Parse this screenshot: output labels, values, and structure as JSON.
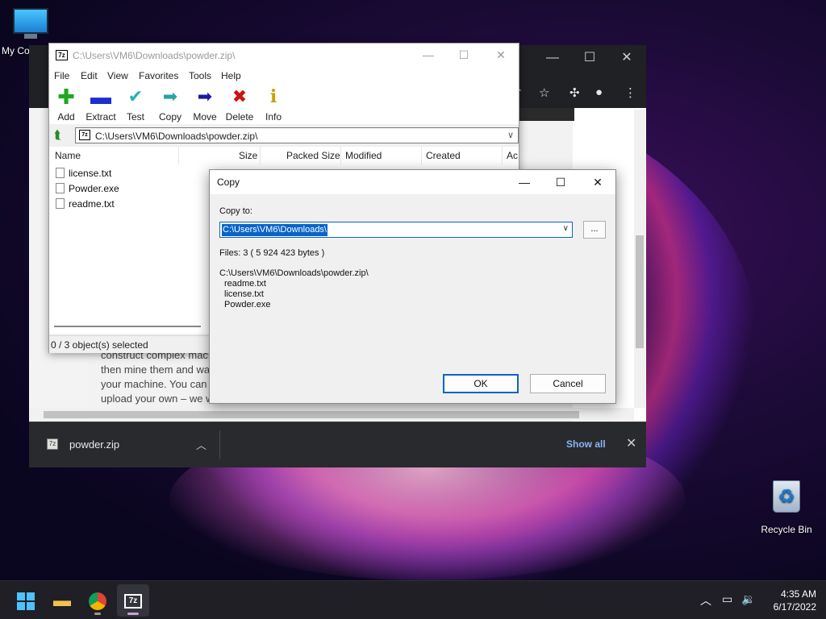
{
  "desktop": {
    "icons": [
      {
        "label": "My Co"
      },
      {
        "label": "Recycle Bin"
      }
    ]
  },
  "chrome": {
    "page_text": [
      "construct complex mac",
      "then mine them and wa",
      "your machine. You can",
      "upload your own – we w"
    ],
    "downloads": {
      "file": "powder.zip",
      "show_all": "Show all"
    }
  },
  "sevenzip": {
    "title": "C:\\Users\\VM6\\Downloads\\powder.zip\\",
    "menu": [
      "File",
      "Edit",
      "View",
      "Favorites",
      "Tools",
      "Help"
    ],
    "toolbar": [
      {
        "label": "Add",
        "icon": "plus-icon",
        "color": "#1fa81f"
      },
      {
        "label": "Extract",
        "icon": "minus-icon",
        "color": "#1a2fd0"
      },
      {
        "label": "Test",
        "icon": "check-icon",
        "color": "#22b3b3"
      },
      {
        "label": "Copy",
        "icon": "copy-arrow-icon",
        "color": "#2aa3a3"
      },
      {
        "label": "Move",
        "icon": "move-arrow-icon",
        "color": "#1a1aa0"
      },
      {
        "label": "Delete",
        "icon": "delete-x-icon",
        "color": "#d01010"
      },
      {
        "label": "Info",
        "icon": "info-icon",
        "color": "#c8a000"
      }
    ],
    "address": "C:\\Users\\VM6\\Downloads\\powder.zip\\",
    "columns": [
      "Name",
      "Size",
      "Packed Size",
      "Modified",
      "Created",
      "Ac"
    ],
    "files": [
      "license.txt",
      "Powder.exe",
      "readme.txt"
    ],
    "status": "0 / 3 object(s) selected"
  },
  "copy_dialog": {
    "title": "Copy",
    "copy_to_label": "Copy to:",
    "destination": "C:\\Users\\VM6\\Downloads\\",
    "browse_label": "...",
    "files_summary": "Files: 3    ( 5 924 423 bytes )",
    "archive_path": "C:\\Users\\VM6\\Downloads\\powder.zip\\",
    "file_list": [
      "readme.txt",
      "license.txt",
      "Powder.exe"
    ],
    "ok_label": "OK",
    "cancel_label": "Cancel"
  },
  "taskbar": {
    "time": "4:35 AM",
    "date": "6/17/2022"
  }
}
